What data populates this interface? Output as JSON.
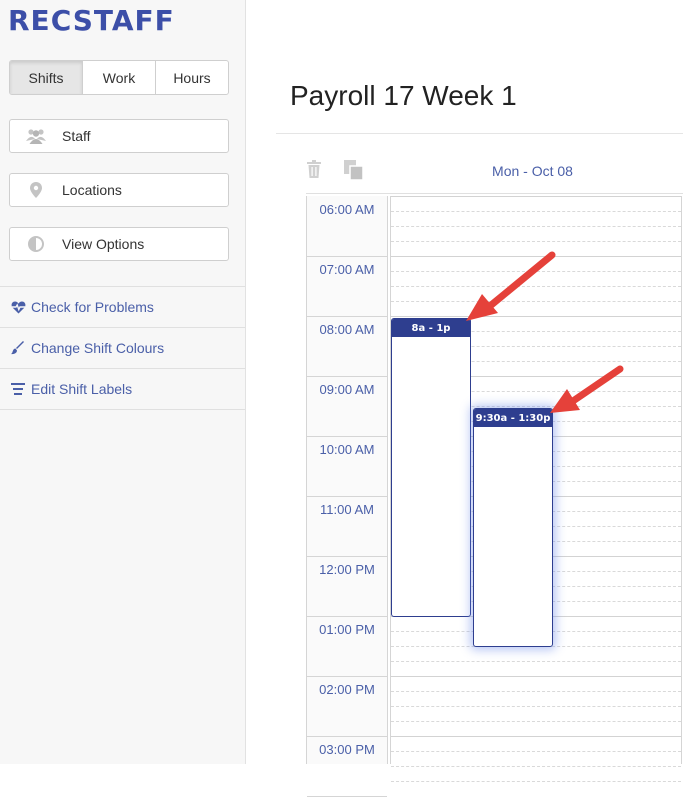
{
  "app": {
    "logo": "RECSTAFF"
  },
  "sidebar": {
    "view_tabs": [
      {
        "label": "Shifts",
        "active": true
      },
      {
        "label": "Work",
        "active": false
      },
      {
        "label": "Hours",
        "active": false
      }
    ],
    "buttons": [
      {
        "label": "Staff",
        "icon": "people-icon"
      },
      {
        "label": "Locations",
        "icon": "location-pin-icon"
      },
      {
        "label": "View Options",
        "icon": "contrast-icon"
      }
    ],
    "links": [
      {
        "label": "Check for Problems",
        "icon": "heartbeat-icon"
      },
      {
        "label": "Change Shift Colours",
        "icon": "brush-icon"
      },
      {
        "label": "Edit Shift Labels",
        "icon": "align-lines-icon"
      }
    ]
  },
  "main": {
    "title": "Payroll 17 Week 1",
    "toolbar": {
      "delete_icon": "trash-icon",
      "copy_icon": "copy-icon"
    },
    "day_header": "Mon - Oct 08",
    "hours": [
      "06:00 AM",
      "07:00 AM",
      "08:00 AM",
      "09:00 AM",
      "10:00 AM",
      "11:00 AM",
      "12:00 PM",
      "01:00 PM",
      "02:00 PM",
      "03:00 PM"
    ],
    "shifts": [
      {
        "label": "8a - 1p"
      },
      {
        "label": "9:30a - 1:30p"
      }
    ]
  },
  "colors": {
    "brand": "#3c4fa8",
    "shift": "#2e3e8f",
    "link": "#4a5fa8",
    "arrow": "#e5413a"
  }
}
